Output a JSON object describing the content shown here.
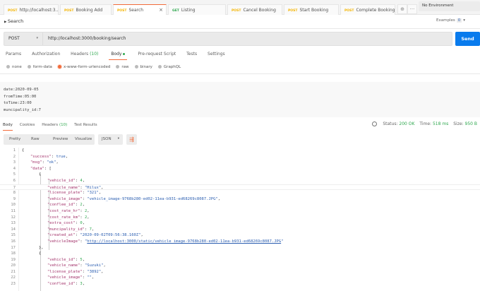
{
  "tabs": [
    {
      "method": "POST",
      "label": "http://localhost:3...",
      "active": false
    },
    {
      "method": "POST",
      "label": "Booking Add",
      "active": false
    },
    {
      "method": "POST",
      "label": "Search",
      "active": true
    },
    {
      "method": "GET",
      "label": "Listing",
      "active": false
    },
    {
      "method": "POST",
      "label": "Cancel Booking",
      "active": false
    },
    {
      "method": "POST",
      "label": "Start Booking",
      "active": false
    },
    {
      "method": "POST",
      "label": "Complete Booking",
      "active": false
    }
  ],
  "environment": "No Environment",
  "request": {
    "title": "Search",
    "examples_label": "Examples",
    "examples_count": "0",
    "method": "POST",
    "url": "http://localhost:3000/booking/search",
    "send": "Send"
  },
  "req_tabs": {
    "params": "Params",
    "authorization": "Authorization",
    "headers": "Headers",
    "headers_count": "(10)",
    "body": "Body",
    "prerequest": "Pre-request Script",
    "tests": "Tests",
    "settings": "Settings"
  },
  "body_types": [
    "none",
    "form-data",
    "x-www-form-urlencoded",
    "raw",
    "binary",
    "GraphQL"
  ],
  "body_lines": [
    "date:2020-09-05",
    "fromTime:05:00",
    "toTime:23:00",
    "muncipality_id:7"
  ],
  "resp_tabs": {
    "body": "Body",
    "cookies": "Cookies",
    "headers": "Headers",
    "headers_count": "(10)",
    "test_results": "Test Results"
  },
  "status": {
    "status_label": "Status:",
    "status": "200 OK",
    "time_label": "Time:",
    "time": "518 ms",
    "size_label": "Size:",
    "size": "950 B"
  },
  "view_modes": [
    "Pretty",
    "Raw",
    "Preview",
    "Visualize"
  ],
  "format": "JSON",
  "code_lines": [
    [
      0,
      [
        [
          "p",
          "{"
        ]
      ]
    ],
    [
      1,
      [
        [
          "k",
          "\"success\""
        ],
        [
          "p",
          ": "
        ],
        [
          "b",
          "true"
        ],
        [
          "p",
          ","
        ]
      ]
    ],
    [
      1,
      [
        [
          "k",
          "\"msg\""
        ],
        [
          "p",
          ": "
        ],
        [
          "s",
          "\"ok\""
        ],
        [
          "p",
          ","
        ]
      ]
    ],
    [
      1,
      [
        [
          "k",
          "\"data\""
        ],
        [
          "p",
          ": ["
        ]
      ]
    ],
    [
      2,
      [
        [
          "p",
          "{"
        ]
      ]
    ],
    [
      3,
      [
        [
          "k",
          "\"vehicle_id\""
        ],
        [
          "p",
          ": "
        ],
        [
          "num",
          "4"
        ],
        [
          "p",
          ","
        ]
      ]
    ],
    [
      3,
      [
        [
          "k",
          "\"vehicle_name\""
        ],
        [
          "p",
          ": "
        ],
        [
          "s",
          "\"Hilux\""
        ],
        [
          "p",
          ","
        ]
      ]
    ],
    [
      3,
      [
        [
          "k",
          "\"license_plate\""
        ],
        [
          "p",
          ": "
        ],
        [
          "s",
          "\"321\""
        ],
        [
          "p",
          ","
        ]
      ]
    ],
    [
      3,
      [
        [
          "k",
          "\"vehicle_image\""
        ],
        [
          "p",
          ": "
        ],
        [
          "s",
          "\"vehicle_image-9768b280-ed02-11ea-b931-ed68269c8087.JPG\""
        ],
        [
          "p",
          ","
        ]
      ]
    ],
    [
      3,
      [
        [
          "k",
          "\"conflee_id\""
        ],
        [
          "p",
          ": "
        ],
        [
          "num",
          "2"
        ],
        [
          "p",
          ","
        ]
      ]
    ],
    [
      3,
      [
        [
          "k",
          "\"cost_rate_hr\""
        ],
        [
          "p",
          ": "
        ],
        [
          "num",
          "2"
        ],
        [
          "p",
          ","
        ]
      ]
    ],
    [
      3,
      [
        [
          "k",
          "\"cost_rate_km\""
        ],
        [
          "p",
          ": "
        ],
        [
          "num",
          "2"
        ],
        [
          "p",
          ","
        ]
      ]
    ],
    [
      3,
      [
        [
          "k",
          "\"extra_cost\""
        ],
        [
          "p",
          ": "
        ],
        [
          "num",
          "0"
        ],
        [
          "p",
          ","
        ]
      ]
    ],
    [
      3,
      [
        [
          "k",
          "\"muncipality_id\""
        ],
        [
          "p",
          ": "
        ],
        [
          "num",
          "7"
        ],
        [
          "p",
          ","
        ]
      ]
    ],
    [
      3,
      [
        [
          "k",
          "\"created_at\""
        ],
        [
          "p",
          ": "
        ],
        [
          "s",
          "\"2020-09-02T09:56:38.160Z\""
        ],
        [
          "p",
          ","
        ]
      ]
    ],
    [
      3,
      [
        [
          "k",
          "\"vehicleImage\""
        ],
        [
          "p",
          ": "
        ],
        [
          "s",
          "\""
        ],
        [
          "lnk",
          "http://localhost:3000/static/vehicle_image-9768b280-ed02-11ea-b931-ed68269c8087.JPG"
        ],
        [
          "s",
          "\""
        ]
      ]
    ],
    [
      2,
      [
        [
          "p",
          "},"
        ]
      ]
    ],
    [
      2,
      [
        [
          "p",
          "{"
        ]
      ]
    ],
    [
      3,
      [
        [
          "k",
          "\"vehicle_id\""
        ],
        [
          "p",
          ": "
        ],
        [
          "num",
          "5"
        ],
        [
          "p",
          ","
        ]
      ]
    ],
    [
      3,
      [
        [
          "k",
          "\"vehicle_name\""
        ],
        [
          "p",
          ": "
        ],
        [
          "s",
          "\"Suzuki\""
        ],
        [
          "p",
          ","
        ]
      ]
    ],
    [
      3,
      [
        [
          "k",
          "\"license_plate\""
        ],
        [
          "p",
          ": "
        ],
        [
          "s",
          "\"3892\""
        ],
        [
          "p",
          ","
        ]
      ]
    ],
    [
      3,
      [
        [
          "k",
          "\"vehicle_image\""
        ],
        [
          "p",
          ": "
        ],
        [
          "s",
          "\"\""
        ],
        [
          "p",
          ","
        ]
      ]
    ],
    [
      3,
      [
        [
          "k",
          "\"conflee_id\""
        ],
        [
          "p",
          ": "
        ],
        [
          "num",
          "3"
        ],
        [
          "p",
          ","
        ]
      ]
    ]
  ]
}
